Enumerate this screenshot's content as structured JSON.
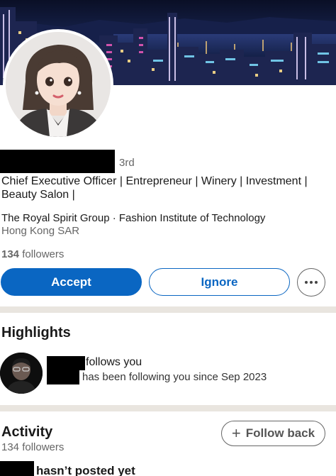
{
  "profile": {
    "degree": "3rd",
    "headline": "Chief Executive Officer | Entrepreneur | Winery | Investment | Beauty Salon |",
    "organizations": "The Royal Spirit Group · Fashion Institute of Technology",
    "location": "Hong Kong SAR",
    "followers_count": "134",
    "followers_label": "followers"
  },
  "actions": {
    "accept_label": "Accept",
    "ignore_label": "Ignore",
    "more_icon": "more-horizontal-icon"
  },
  "highlights": {
    "title": "Highlights",
    "follows_text": "follows you",
    "since_text": "has been following you since Sep 2023"
  },
  "activity": {
    "title": "Activity",
    "followers_text": "134 followers",
    "follow_back_label": "Follow back",
    "follow_back_icon": "plus-icon",
    "posted_text": "hasn’t posted yet"
  },
  "colors": {
    "primary": "#0a66c2",
    "divider": "#e9e5df",
    "secondary_text": "#666666"
  }
}
